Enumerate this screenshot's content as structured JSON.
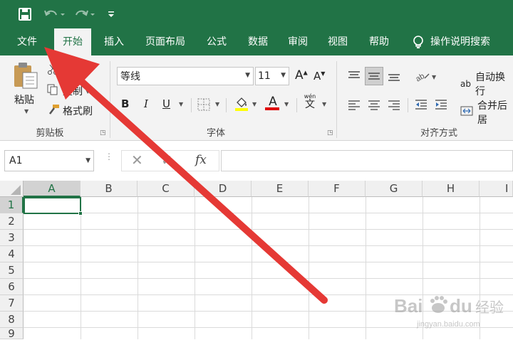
{
  "qat": {
    "save_icon": "save-icon",
    "undo_icon": "undo-icon",
    "redo_icon": "redo-icon",
    "customize_icon": "customize-icon"
  },
  "tabs": [
    {
      "label": "文件"
    },
    {
      "label": "开始"
    },
    {
      "label": "插入"
    },
    {
      "label": "页面布局"
    },
    {
      "label": "公式"
    },
    {
      "label": "数据"
    },
    {
      "label": "审阅"
    },
    {
      "label": "视图"
    },
    {
      "label": "帮助"
    }
  ],
  "tell_me": {
    "label": "操作说明搜索"
  },
  "clipboard": {
    "paste_label": "粘贴",
    "cut_label": "切",
    "copy_label": "复制",
    "format_painter_label": "格式刷",
    "group_label": "剪贴板"
  },
  "font": {
    "font_name": "等线",
    "font_size": "11",
    "grow_label": "A",
    "shrink_label": "A",
    "bold": "B",
    "italic": "I",
    "underline": "U",
    "fill_label": "",
    "font_color_label": "A",
    "phonetic_top": "wén",
    "phonetic_bottom": "文",
    "group_label": "字体"
  },
  "alignment": {
    "wrap_label": "自动换行",
    "merge_label": "合并后居",
    "orientation_label": "ab",
    "group_label": "对齐方式"
  },
  "formula_bar": {
    "name_box": "A1",
    "fx": "fx",
    "content": ""
  },
  "grid": {
    "columns": [
      "A",
      "B",
      "C",
      "D",
      "E",
      "F",
      "G",
      "H",
      "I"
    ],
    "rows": [
      "1",
      "2",
      "3",
      "4",
      "5",
      "6",
      "7",
      "8",
      "9"
    ],
    "selected_cell": "A1"
  },
  "colors": {
    "brand": "#217346",
    "arrow": "#e53935",
    "fill_yellow": "#ffff00",
    "font_red": "#e00000"
  },
  "watermark": {
    "brand": "Baidu",
    "sub": "经验",
    "url": "jingyan.baidu.com"
  }
}
